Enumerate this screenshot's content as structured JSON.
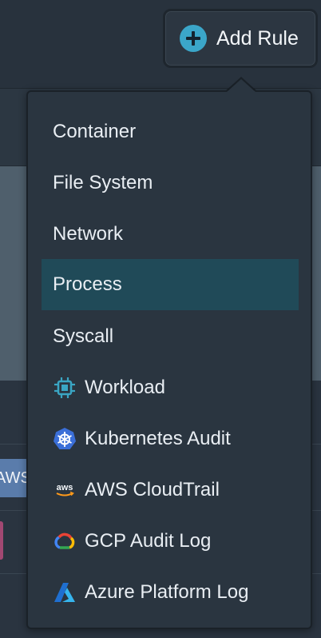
{
  "header": {
    "add_rule_label": "Add Rule"
  },
  "background": {
    "chip_text": "AWS"
  },
  "menu": {
    "selected_index": 3,
    "items": [
      {
        "label": "Container",
        "icon": ""
      },
      {
        "label": "File System",
        "icon": ""
      },
      {
        "label": "Network",
        "icon": ""
      },
      {
        "label": "Process",
        "icon": ""
      },
      {
        "label": "Syscall",
        "icon": ""
      },
      {
        "label": "Workload",
        "icon": "chip-icon"
      },
      {
        "label": "Kubernetes Audit",
        "icon": "kubernetes-icon"
      },
      {
        "label": "AWS CloudTrail",
        "icon": "aws-icon"
      },
      {
        "label": "GCP Audit Log",
        "icon": "gcp-icon"
      },
      {
        "label": "Azure Platform Log",
        "icon": "azure-icon"
      }
    ]
  },
  "colors": {
    "accent": "#3ba6c9",
    "selected_bg": "#204a58",
    "menu_bg": "#2a3540",
    "page_bg": "#2a3440"
  }
}
